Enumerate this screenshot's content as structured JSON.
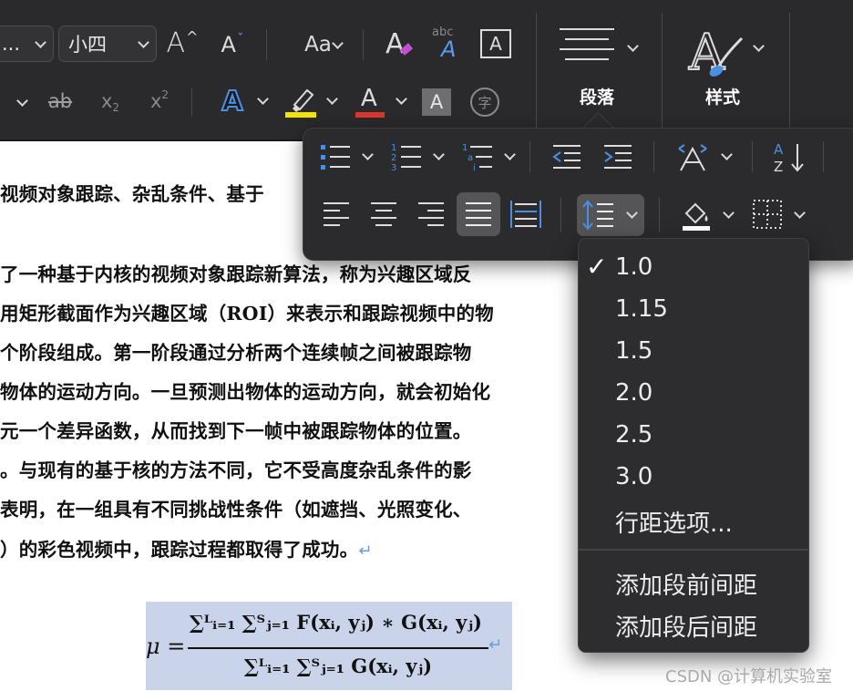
{
  "ribbon": {
    "font_name_partial": "...",
    "font_size": "小四",
    "grow_font_glyph": "A",
    "shrink_font_glyph": "A",
    "change_case_label": "Aa",
    "paragraph_label": "段落",
    "styles_label": "样式",
    "strike_label": "ab",
    "subscript_label": "x",
    "subscript_sub": "2",
    "superscript_label": "x",
    "superscript_sup": "2",
    "text_effect_glyph": "A",
    "font_color_glyph": "A",
    "char_shading_glyph": "A",
    "enclose_char_glyph": "字",
    "phonetic_label": "abc",
    "char_border_glyph": "A",
    "highlight_color": "#f2e600",
    "font_color": "#e0352b"
  },
  "document": {
    "lines": [
      "视频对象跟踪、杂乱条件、基于",
      "了一种基于内核的视频对象跟踪新算法，称为兴趣区域反",
      "用矩形截面作为兴趣区域（ROI）来表示和跟踪视频中的物",
      "个阶段组成。第一阶段通过分析两个连续帧之间被跟踪物",
      "物体的运动方向。一旦预测出物体的运动方向，就会初始化",
      "元一个差异函数，从而找到下一帧中被跟踪物体的位置。",
      "。与现有的基于核的方法不同，它不受高度杂乱条件的影",
      "表明，在一组具有不同挑战性条件（如遮挡、光照变化、",
      "）的彩色视频中，跟踪过程都取得了成功。"
    ],
    "paragraph_mark": "↵",
    "formula": {
      "lhs": "μ =",
      "numerator": "∑ᴸᵢ₌₁ ∑ᵀⱼ₌₁ F(xᵢ, yⱼ) ∗ G(xᵢ, yⱼ)",
      "denominator": "∑ᴸᵢ₌₁ ∑ᵀⱼ₌₁ G(xᵢ, yⱼ)"
    }
  },
  "paragraph_popover": {
    "row1": [
      "bullets-icon",
      "numbering-icon",
      "multilevel-list-icon",
      "decrease-indent-icon",
      "increase-indent-icon",
      "text-direction-icon",
      "sort-icon"
    ],
    "row2": [
      "align-left-icon",
      "align-center-icon",
      "align-right-icon",
      "justify-icon",
      "distributed-icon",
      "line-spacing-icon",
      "shading-icon",
      "borders-icon"
    ],
    "sort_label": "A Z"
  },
  "line_spacing_menu": {
    "checkmark": "✓",
    "selected": "1.0",
    "options": [
      "1.0",
      "1.15",
      "1.5",
      "2.0",
      "2.5",
      "3.0"
    ],
    "line_spacing_options": "行距选项...",
    "add_space_before": "添加段前间距",
    "add_space_after": "添加段后间距"
  },
  "watermark": "CSDN @计算机实验室",
  "colors": {
    "ribbon_bg": "#2a2a2c",
    "accent_blue": "#4a90e2",
    "formula_bg": "#c9d4ea"
  }
}
